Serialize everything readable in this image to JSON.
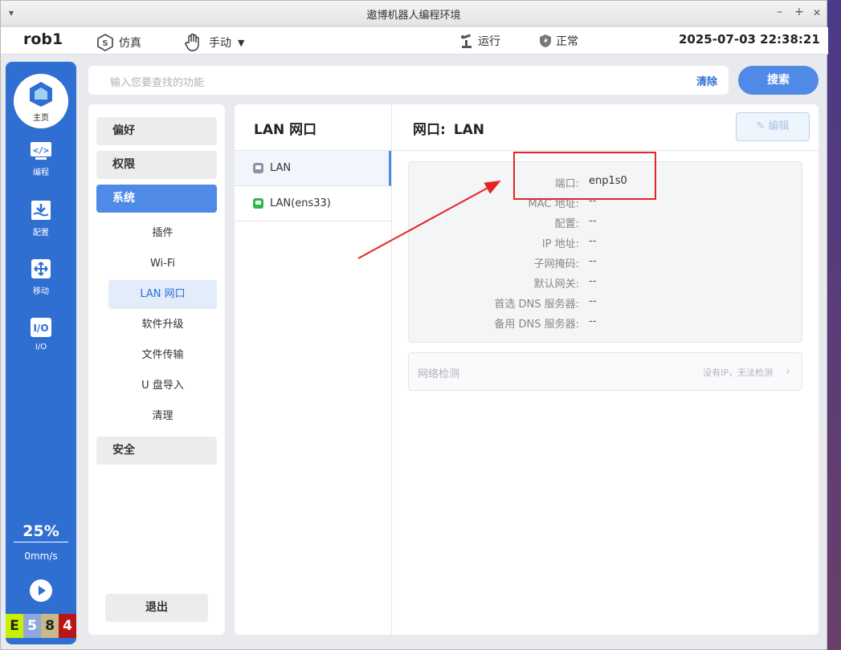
{
  "window": {
    "title": "遨博机器人编程环境",
    "menu_glyph": "▾",
    "min_glyph": "–",
    "max_glyph": "+",
    "close_glyph": "✕"
  },
  "header": {
    "robot_name": "rob1",
    "sim_label": "仿真",
    "mode_label": "手动",
    "run_label": "运行",
    "status_label": "正常",
    "datetime": "2025-07-03 22:38:21"
  },
  "leftnav": {
    "home_label": "主页",
    "items": [
      {
        "label": "编程",
        "icon": "code-icon"
      },
      {
        "label": "配置",
        "icon": "config-icon"
      },
      {
        "label": "移动",
        "icon": "move-icon"
      },
      {
        "label": "I/O",
        "icon": "io-icon"
      }
    ],
    "speed_percent": "25%",
    "speed_value": "0mm/s",
    "status_codes": [
      {
        "char": "E",
        "bg": "#c8f000",
        "fg": "#222222"
      },
      {
        "char": "5",
        "bg": "#8fa8d8",
        "fg": "#ffffff"
      },
      {
        "char": "8",
        "bg": "#c9b98a",
        "fg": "#222222"
      },
      {
        "char": "4",
        "bg": "#b8151b",
        "fg": "#ffffff"
      }
    ]
  },
  "search": {
    "placeholder": "输入您要查找的功能",
    "clear_label": "清除",
    "button_label": "搜索"
  },
  "settings_menu": {
    "categories": [
      "偏好",
      "权限",
      "系统",
      "安全"
    ],
    "system_items": [
      "插件",
      "Wi-Fi",
      "LAN 网口",
      "软件升级",
      "文件传输",
      "U 盘导入",
      "清理"
    ],
    "logout_label": "退出"
  },
  "lan": {
    "list_title": "LAN 网口",
    "ports": [
      {
        "name": "LAN",
        "color": "#8a94a6"
      },
      {
        "name": "LAN(ens33)",
        "color": "#2fb84a"
      }
    ],
    "detail_prefix": "网口:",
    "detail_name": "LAN",
    "edit_label": "编辑",
    "fields": [
      {
        "key": "端口:",
        "value": "enp1s0"
      },
      {
        "key": "MAC 地址:",
        "value": "--"
      },
      {
        "key": "配置:",
        "value": "--"
      },
      {
        "key": "IP 地址:",
        "value": "--"
      },
      {
        "key": "子网掩码:",
        "value": "--"
      },
      {
        "key": "默认网关:",
        "value": "--"
      },
      {
        "key": "首选 DNS 服务器:",
        "value": "--"
      },
      {
        "key": "备用 DNS 服务器:",
        "value": "--"
      }
    ],
    "net_check_label": "网络检测",
    "net_check_hint": "没有IP，无法检测"
  },
  "colors": {
    "accent": "#2f6fd1",
    "annotation_red": "#e82323"
  }
}
